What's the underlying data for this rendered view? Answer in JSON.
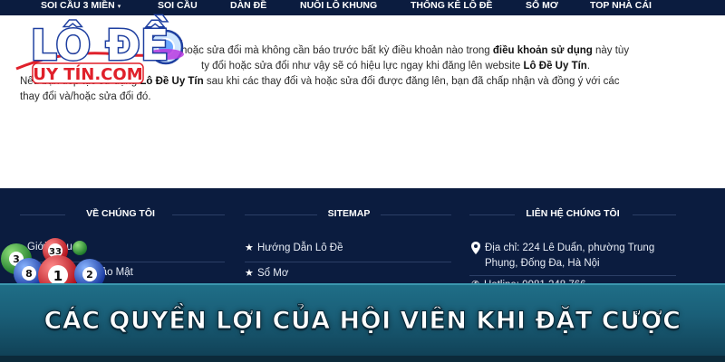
{
  "nav": {
    "items": [
      {
        "label": "SOI CẦU 3 MIỀN",
        "has_caret": true
      },
      {
        "label": "SOI CẦU"
      },
      {
        "label": "DÀN ĐỀ"
      },
      {
        "label": "NUÔI LÔ KHUNG"
      },
      {
        "label": "THỐNG KÊ LÔ ĐỀ"
      },
      {
        "label": "SỔ MƠ"
      },
      {
        "label": "TOP NHÀ CÁI"
      }
    ],
    "caret": "▾"
  },
  "logo": {
    "text_top": "LÔ ĐỀ",
    "text_bottom": "UY TÍN.COM"
  },
  "content": {
    "line1_a": "hoặc sửa đổi mà không cần báo trước bất kỳ điều khoản nào trong ",
    "line1_b": "điều khoản sử dụng",
    "line1_c": " này tùy",
    "line2_a": "ty đổi hoặc sửa đổi như vậy sẽ có hiệu lực ngay khi đăng lên website ",
    "line2_b": "Lô Đề Uy Tín",
    "line2_c": ".",
    "line3_a": "Nếu bạn tiếp tục sử dụng ",
    "line3_b": "Lô Đề Uy Tín",
    "line3_c": " sau khi các thay đổi và hoặc sửa đổi được đăng lên, bạn đã chấp nhận và đồng ý với các",
    "line4": "thay đổi và/hoặc sửa đổi đó."
  },
  "footer": {
    "col1_title": "VỀ CHÚNG TÔI",
    "col2_title": "SITEMAP",
    "col3_title": "LIÊN HỆ CHÚNG TÔI",
    "col1_links": [
      "Giới thiệu",
      "Bảo Mật"
    ],
    "col2_links": [
      "Hướng Dẫn Lô Đề",
      "Sổ Mơ"
    ],
    "address": "Địa chỉ: 224 Lê Duẩn, phường Trung Phụng, Đống Đa, Hà Nội",
    "hotline": "Hotline: 0981 248 766",
    "star_icon": "star-icon",
    "pin_icon": "location-pin-icon"
  },
  "balls": [
    "3",
    "33",
    "8",
    "1",
    "2"
  ],
  "banner": {
    "title": "CÁC QUYỀN LỢI CỦA HỘI VIÊN KHI ĐẶT CƯỢC"
  },
  "colors": {
    "navy": "#0b1c3f",
    "banner_teal": "#1f6f88",
    "logo_blue": "#1e3fa0",
    "logo_red": "#e0202a"
  }
}
